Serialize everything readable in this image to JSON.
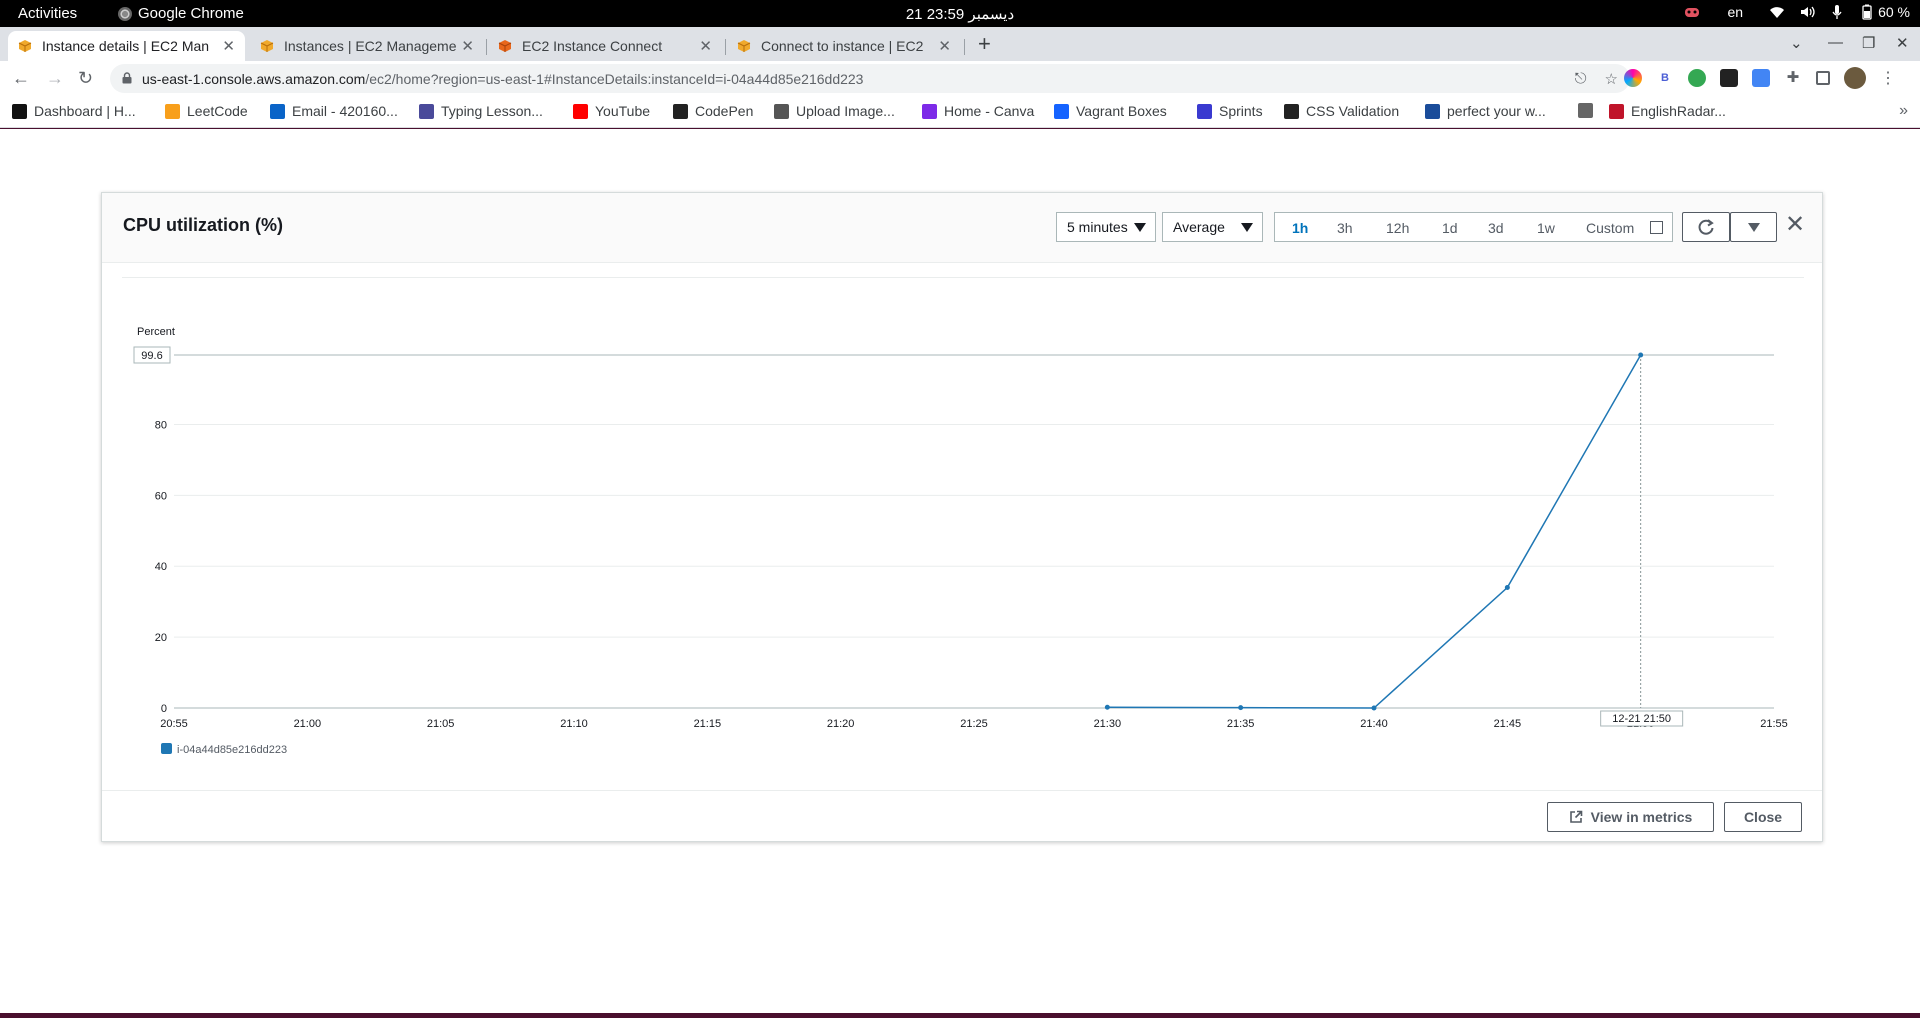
{
  "system_bar": {
    "activities": "Activities",
    "app_name": "Google Chrome",
    "clock": "21 ديسمبر  23:59",
    "keyboard_layout": "en",
    "battery": "60 %"
  },
  "browser": {
    "tabs": [
      {
        "title": "Instance details | EC2 Man",
        "favicon": "aws-cube-icon",
        "active": true
      },
      {
        "title": "Instances | EC2 Manageme",
        "favicon": "aws-cube-icon",
        "active": false
      },
      {
        "title": "EC2 Instance Connect",
        "favicon": "ec2-orange-icon",
        "active": false
      },
      {
        "title": "Connect to instance | EC2",
        "favicon": "aws-cube-icon",
        "active": false
      }
    ],
    "url_host": "us-east-1.console.aws.amazon.com",
    "url_path": "/ec2/home?region=us-east-1#InstanceDetails:instanceId=i-04a44d85e216dd223",
    "bookmarks": [
      {
        "label": "Dashboard | H...",
        "icon": "dashboard-icon",
        "color": "#111111"
      },
      {
        "label": "LeetCode",
        "icon": "leetcode-icon",
        "color": "#f89f1b"
      },
      {
        "label": "Email - 420160...",
        "icon": "outlook-icon",
        "color": "#0a64c8"
      },
      {
        "label": "Typing Lesson...",
        "icon": "typing-icon",
        "color": "#4a4a9a"
      },
      {
        "label": "YouTube",
        "icon": "youtube-icon",
        "color": "#ff0000"
      },
      {
        "label": "CodePen",
        "icon": "codepen-icon",
        "color": "#222222"
      },
      {
        "label": "Upload Image...",
        "icon": "upload-icon",
        "color": "#555555"
      },
      {
        "label": "Home - Canva",
        "icon": "canva-icon",
        "color": "#7d2ae8"
      },
      {
        "label": "Vagrant Boxes",
        "icon": "vagrant-icon",
        "color": "#1563ff"
      },
      {
        "label": "Sprints",
        "icon": "sprints-icon",
        "color": "#3a3ad0"
      },
      {
        "label": "CSS Validation",
        "icon": "w3c-icon",
        "color": "#222222"
      },
      {
        "label": "perfect your w...",
        "icon": "tr-icon",
        "color": "#1a4c9a"
      },
      {
        "label": "",
        "icon": "globe-icon",
        "color": "#666666"
      },
      {
        "label": "EnglishRadar...",
        "icon": "englishradar-icon",
        "color": "#c0142a"
      }
    ]
  },
  "modal": {
    "title": "CPU utilization (%)",
    "period_select": "5 minutes",
    "stat_select": "Average",
    "ranges": [
      "1h",
      "3h",
      "12h",
      "1d",
      "3d",
      "1w"
    ],
    "active_range": "1h",
    "custom_label": "Custom",
    "view_in_metrics": "View in metrics",
    "close": "Close"
  },
  "chart_data": {
    "type": "line",
    "title": "",
    "ylabel": "Percent",
    "xlabel": "",
    "ylim": [
      0,
      99.6
    ],
    "y_ticks": [
      0,
      20,
      40,
      60,
      80
    ],
    "y_max_label": "99.6",
    "x_ticks": [
      "20:55",
      "21:00",
      "21:05",
      "21:10",
      "21:15",
      "21:20",
      "21:25",
      "21:30",
      "21:35",
      "21:40",
      "21:45",
      "21:50",
      "21:55"
    ],
    "series": [
      {
        "name": "i-04a44d85e216dd223",
        "color": "#1f77b4",
        "x": [
          "21:30",
          "21:35",
          "21:40",
          "21:45",
          "21:50"
        ],
        "values": [
          0.2,
          0.1,
          0.0,
          34.0,
          99.6
        ]
      }
    ],
    "hover_marker": {
      "x": "21:50",
      "label": "12-21 21:50"
    },
    "legend": "bottom-left",
    "grid": true
  }
}
